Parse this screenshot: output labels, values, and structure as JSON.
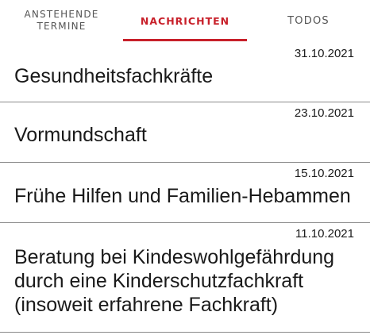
{
  "tabs": [
    {
      "label_line1": "ANSTEHENDE",
      "label_line2": "TERMINE",
      "active": false
    },
    {
      "label": "NACHRICHTEN",
      "active": true
    },
    {
      "label": "TODOS",
      "active": false
    }
  ],
  "colors": {
    "accent": "#c8202a",
    "divider": "#8a8a8a",
    "text": "#1a1a1a",
    "tab_inactive": "#555555"
  },
  "news": [
    {
      "date": "31.10.2021",
      "title": "Gesundheitsfachkräfte"
    },
    {
      "date": "23.10.2021",
      "title": "Vormundschaft"
    },
    {
      "date": "15.10.2021",
      "title": "Frühe Hilfen und Familien-Hebammen"
    },
    {
      "date": "11.10.2021",
      "title": "Beratung bei Kindeswohlgefährdung\ndurch eine Kinderschutzfachkraft\n(insoweit erfahrene Fachkraft)"
    }
  ]
}
